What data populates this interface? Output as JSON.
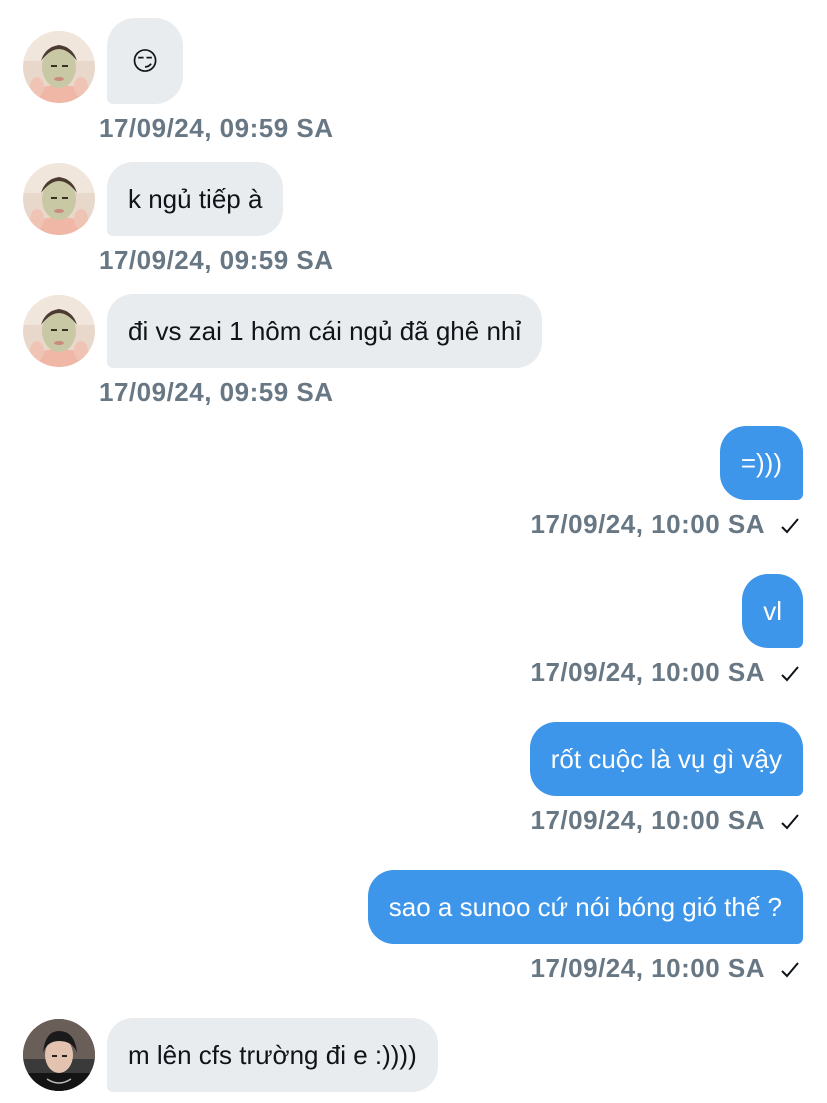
{
  "conversation": {
    "messages": [
      {
        "direction": "in",
        "text": "😏",
        "time": "17/09/24, 09:59 SA",
        "avatar": "contact-avatar-face-mask"
      },
      {
        "direction": "in",
        "text": "k ngủ tiếp à",
        "time": "17/09/24, 09:59 SA",
        "avatar": "contact-avatar-face-mask"
      },
      {
        "direction": "in",
        "text": "đi vs zai 1 hôm cái ngủ đã ghê nhỉ",
        "time": "17/09/24, 09:59 SA",
        "avatar": "contact-avatar-face-mask"
      },
      {
        "direction": "out",
        "text": "=)))",
        "time": "17/09/24, 10:00 SA",
        "status_icon": "checkmark-icon"
      },
      {
        "direction": "out",
        "text": "vl",
        "time": "17/09/24, 10:00 SA",
        "status_icon": "checkmark-icon"
      },
      {
        "direction": "out",
        "text": "rốt cuộc là vụ gì vậy",
        "time": "17/09/24, 10:00 SA",
        "status_icon": "checkmark-icon"
      },
      {
        "direction": "out",
        "text": "sao a sunoo cứ nói bóng gió thế ?",
        "time": "17/09/24, 10:00 SA",
        "status_icon": "checkmark-icon"
      },
      {
        "direction": "in",
        "text": "m lên cfs trường đi e :))))",
        "time": "",
        "avatar": "contact-avatar-dark-hair"
      }
    ]
  },
  "colors": {
    "incoming_bubble": "#e9ecef",
    "outgoing_bubble": "#3d96e9",
    "timestamp": "#687784",
    "background": "#ffffff"
  }
}
